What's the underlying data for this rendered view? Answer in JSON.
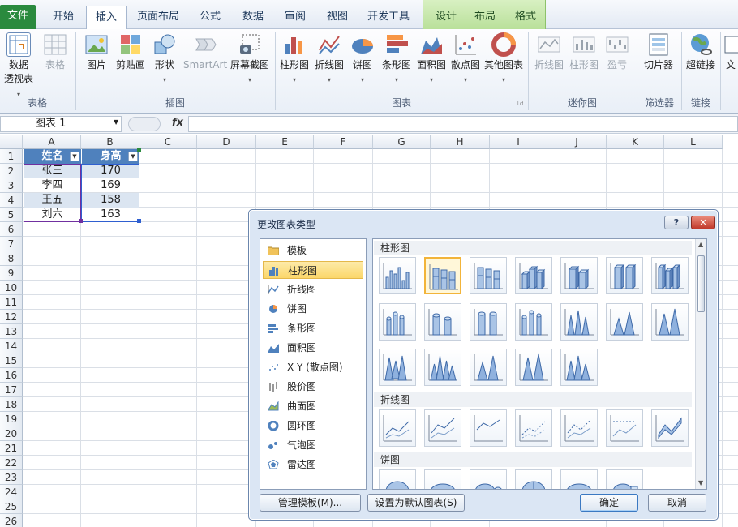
{
  "ribbon_tabs": [
    {
      "label": "文件"
    },
    {
      "label": "开始"
    },
    {
      "label": "插入"
    },
    {
      "label": "页面布局"
    },
    {
      "label": "公式"
    },
    {
      "label": "数据"
    },
    {
      "label": "审阅"
    },
    {
      "label": "视图"
    },
    {
      "label": "开发工具"
    }
  ],
  "context_tabs": [
    {
      "label": "设计"
    },
    {
      "label": "布局"
    },
    {
      "label": "格式"
    }
  ],
  "ribbon": {
    "tables": {
      "pivot": "数据\n透视表",
      "table": "表格",
      "group": "表格"
    },
    "illustrations": {
      "picture": "图片",
      "clipart": "剪贴画",
      "shapes": "形状",
      "smartart": "SmartArt",
      "screenshot": "屏幕截图",
      "group": "插图"
    },
    "charts": {
      "column": "柱形图",
      "line": "折线图",
      "pie": "饼图",
      "bar": "条形图",
      "area": "面积图",
      "scatter": "散点图",
      "other": "其他图表",
      "group": "图表"
    },
    "sparklines": {
      "line": "折线图",
      "column": "柱形图",
      "winloss": "盈亏",
      "group": "迷你图"
    },
    "filter": {
      "slicer": "切片器",
      "group": "筛选器"
    },
    "links": {
      "hyperlink": "超链接",
      "group": "链接"
    },
    "text": {
      "partial": "文"
    }
  },
  "formula_bar": {
    "name_box": "图表 1",
    "fx": "fx",
    "formula": ""
  },
  "columns": [
    "A",
    "B",
    "C",
    "D",
    "E",
    "F",
    "G",
    "H",
    "I",
    "J",
    "K",
    "L"
  ],
  "rows": [
    "1",
    "2",
    "3",
    "4",
    "5",
    "6",
    "7",
    "8",
    "9",
    "10",
    "11",
    "12",
    "13",
    "14",
    "15",
    "16",
    "17",
    "18",
    "19",
    "20",
    "21",
    "22",
    "23",
    "24",
    "25",
    "26"
  ],
  "table": {
    "headers": [
      "姓名",
      "身高"
    ],
    "rows": [
      [
        "张三",
        "170"
      ],
      [
        "李四",
        "169"
      ],
      [
        "王五",
        "158"
      ],
      [
        "刘六",
        "163"
      ]
    ]
  },
  "dialog": {
    "title": "更改图表类型",
    "help": "?",
    "close": "✕",
    "categories": [
      "模板",
      "柱形图",
      "折线图",
      "饼图",
      "条形图",
      "面积图",
      "X Y (散点图)",
      "股价图",
      "曲面图",
      "圆环图",
      "气泡图",
      "雷达图"
    ],
    "selected_category": "柱形图",
    "sections": {
      "column": "柱形图",
      "line": "折线图",
      "pie": "饼图"
    },
    "buttons": {
      "manage": "管理模板(M)...",
      "set_default": "设置为默认图表(S)",
      "ok": "确定",
      "cancel": "取消"
    }
  },
  "colors": {
    "accent": "#4f81bd",
    "file_tab": "#2a8a3e",
    "context": "#b9e09a",
    "selection": "#fbd76a"
  }
}
